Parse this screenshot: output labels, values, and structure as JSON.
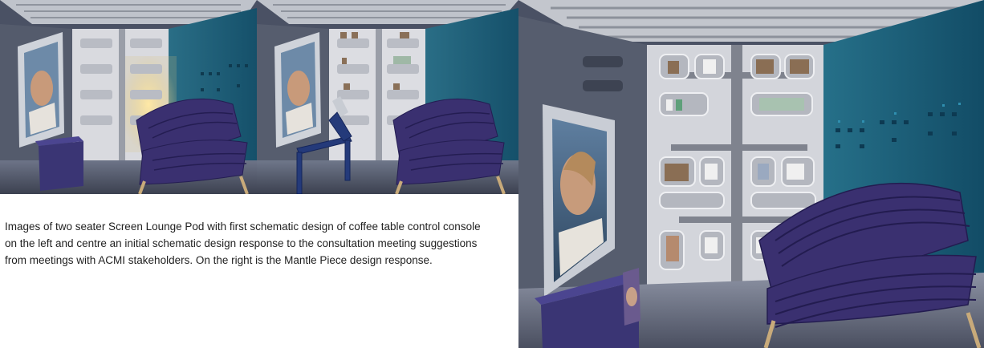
{
  "page": {
    "caption": "Images of two seater Screen Lounge Pod with first schematic design of coffee table control console on the left and centre an initial schematic design response to the consultation meeting suggestions from meetings with ACMI stakeholders. On the right is the Mantle Piece design response."
  },
  "images": [
    {
      "id": "left",
      "depicts": "two seater lounge pod with coffee table control console"
    },
    {
      "id": "centre",
      "depicts": "two seater lounge pod with initial console design"
    },
    {
      "id": "right",
      "depicts": "two seater lounge pod with mantle piece design"
    }
  ],
  "colors": {
    "wall_blue": "#1f6f86",
    "wall_grey": "#4d5566",
    "ceiling": "#c9ccd2",
    "shelf_white": "#dfe0e4",
    "sofa_purple": "#3a3070",
    "console_blue": "#243a7a",
    "screen_frame": "#c7cbd2",
    "caption_text": "#222222"
  }
}
